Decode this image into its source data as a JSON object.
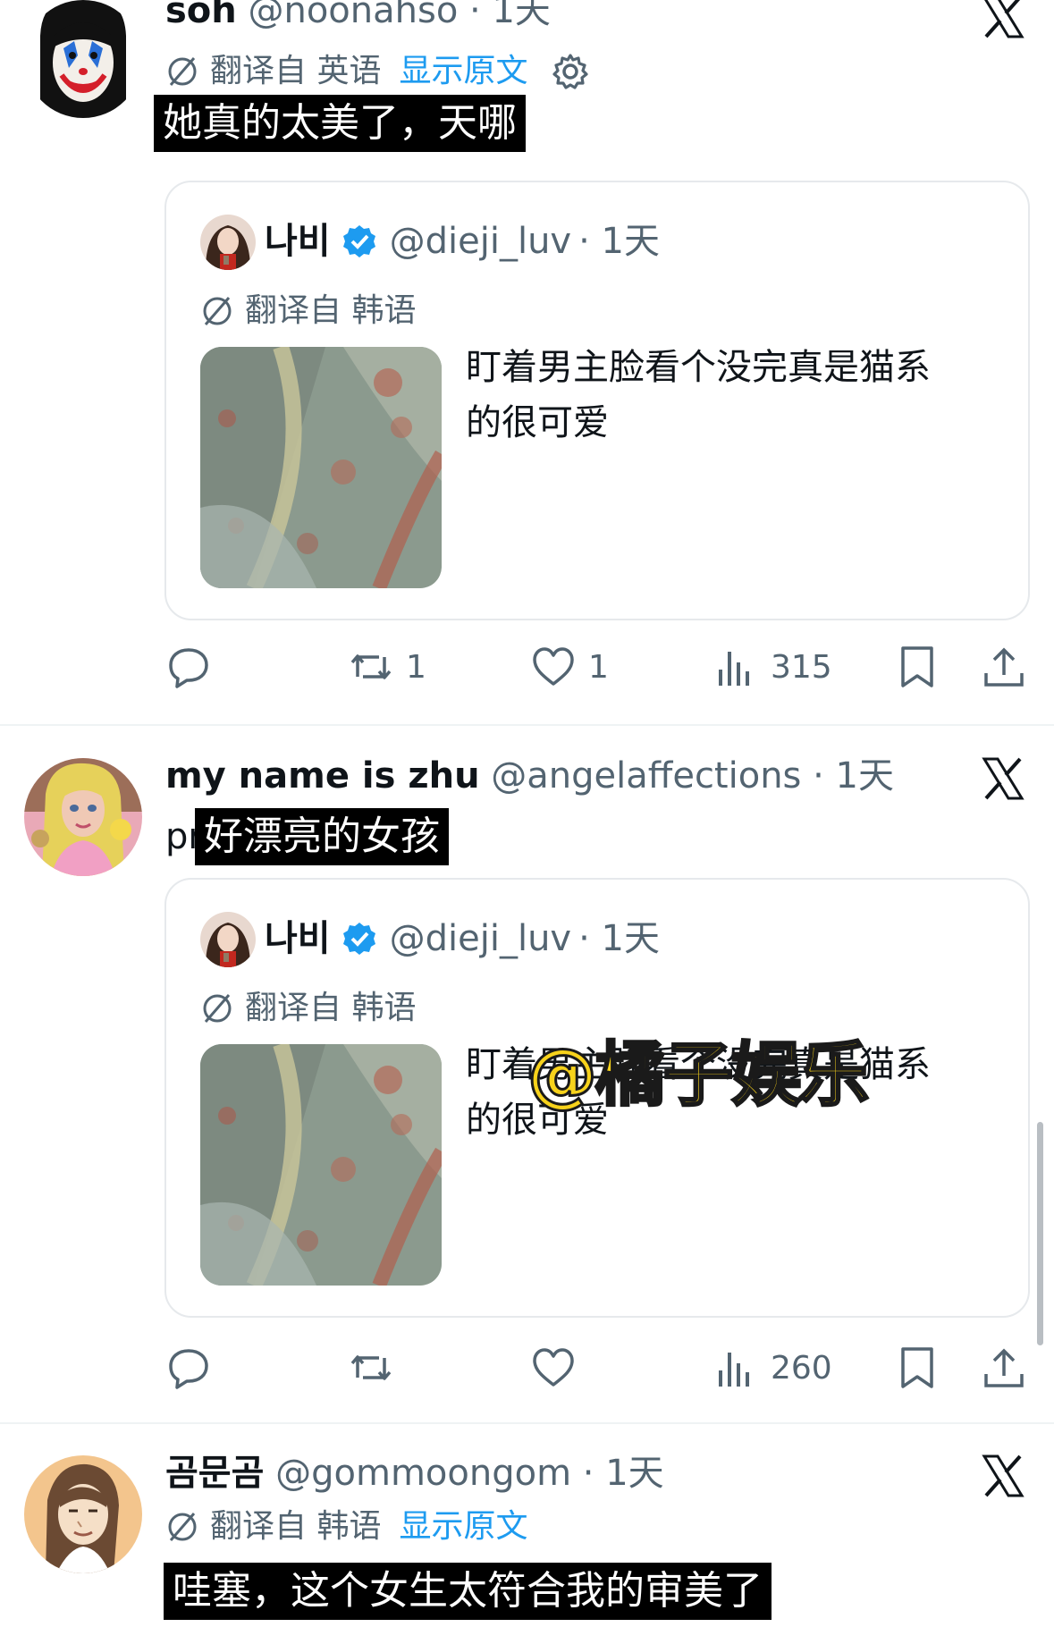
{
  "tweets": [
    {
      "display_name": "soh",
      "handle": "@noonahso",
      "time": "· 1天",
      "translate_label": "翻译自 英语",
      "show_original": "显示原文",
      "caption": "她真的太美了，天哪",
      "quote": {
        "name": "나비",
        "handle": "@dieji_luv",
        "time": "· 1天",
        "translate_label": "翻译自 韩语",
        "text_line1": "盯着男主脸看个没完真是猫系",
        "text_line2": "的很可爱"
      },
      "actions": {
        "replies": "",
        "retweets": "1",
        "likes": "1",
        "views": "315"
      }
    },
    {
      "display_name": "my name is zhu",
      "handle": "@angelaffections",
      "time": "· 1天",
      "prefix": "pr",
      "caption": "好漂亮的女孩",
      "quote": {
        "name": "나비",
        "handle": "@dieji_luv",
        "time": "· 1天",
        "translate_label": "翻译自 韩语",
        "text_line1": "盯着男主脸看个没完真是猫系",
        "text_line2": "的很可爱"
      },
      "actions": {
        "replies": "",
        "retweets": "",
        "likes": "",
        "views": "260"
      }
    },
    {
      "display_name": "곰문곰",
      "handle": "@gommoongom",
      "time": "· 1天",
      "translate_label": "翻译自 韩语",
      "show_original": "显示原文",
      "caption": "哇塞，这个女生太符合我的审美了"
    }
  ],
  "watermark": "@橘子娱乐",
  "colors": {
    "link": "#1d9bf0",
    "secondary_text": "#536471",
    "verified": "#1d9bf0",
    "watermark": "#f7d21b"
  },
  "icons": [
    "x-logo-icon",
    "translate-icon",
    "gear-icon",
    "verified-badge-icon",
    "reply-icon",
    "retweet-icon",
    "like-icon",
    "views-icon",
    "bookmark-icon",
    "share-icon"
  ]
}
